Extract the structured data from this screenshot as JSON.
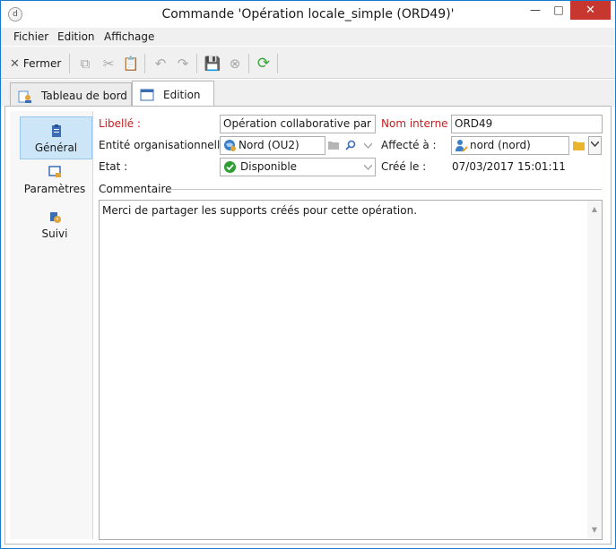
{
  "window": {
    "title": "Commande 'Opération locale_simple  (ORD49)'",
    "app_icon_glyph": "d",
    "min_glyph": "—",
    "max_glyph": "□",
    "close_glyph": "✕"
  },
  "menu": {
    "items": [
      "Fichier",
      "Edition",
      "Affichage"
    ]
  },
  "toolbar": {
    "close_label": "Fermer",
    "close_glyph": "✕",
    "icons": {
      "copy": "⧉",
      "cut": "✂",
      "paste": "📋",
      "undo": "↶",
      "redo": "↷",
      "save": "💾",
      "cancel": "⊗",
      "refresh": "⟳"
    }
  },
  "tabs": [
    {
      "label": "Tableau de bord"
    },
    {
      "label": "Edition"
    }
  ],
  "sidebar": {
    "items": [
      {
        "label": "Général",
        "icon": "clipboard-icon"
      },
      {
        "label": "Paramètres",
        "icon": "settings-screen-icon"
      },
      {
        "label": "Suivi",
        "icon": "tracking-icon"
      }
    ]
  },
  "form": {
    "libelle_label": "Libellé :",
    "libelle_value": "Opération collaborative par opér",
    "nom_interne_label": "Nom interne :",
    "nom_interne_value": "ORD49",
    "entite_label": "Entité organisationnelle :",
    "entite_value": "Nord (OU2)",
    "affecte_label": "Affecté à :",
    "affecte_value": "nord (nord)",
    "etat_label": "Etat :",
    "etat_value": "Disponible",
    "cree_label": "Créé le :",
    "cree_value": "07/03/2017 15:01:11",
    "commentaire_label": "Commentaire",
    "commentaire_value": "Merci de partager les supports créés pour cette opération."
  },
  "colors": {
    "accent": "#1979ca",
    "required_label": "#c81e1e",
    "selected_bg": "#cde6f7",
    "refresh_green": "#3aa53a",
    "status_green": "#2e9e33"
  }
}
